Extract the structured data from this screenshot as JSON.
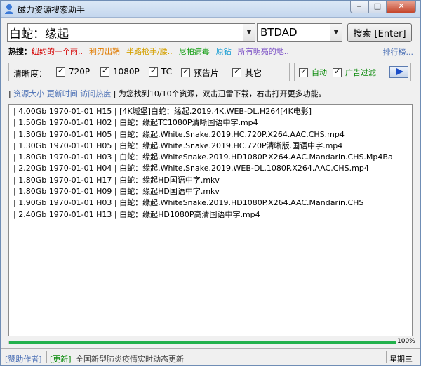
{
  "window": {
    "title": "磁力资源搜索助手",
    "controls": {
      "minimize": "‒",
      "maximize": "□",
      "close": "✕"
    }
  },
  "search": {
    "query": "白蛇：缘起",
    "engine": "BTDAD",
    "button_label": "搜索 [Enter]"
  },
  "hot": {
    "label": "热搜：",
    "keywords": [
      {
        "text": "纽约的一个雨..",
        "color": "#d40000"
      },
      {
        "text": "利刃出鞘",
        "color": "#e07b00"
      },
      {
        "text": "半路枪手/腰..",
        "color": "#d4a000"
      },
      {
        "text": "尼帕病毒",
        "color": "#0a9a0a"
      },
      {
        "text": "原钻",
        "color": "#1e9fd4"
      },
      {
        "text": "所有明亮的地..",
        "color": "#7a4fc5"
      }
    ],
    "rank_link": "排行榜..."
  },
  "filter": {
    "label": "清晰度：",
    "options": [
      "720P",
      "1080P",
      "TC",
      "预告片",
      "其它"
    ]
  },
  "auto": {
    "auto_label": "自动",
    "ad_filter_label": "广告过滤"
  },
  "info": {
    "sort_size": "资源大小",
    "sort_time": "更新时间",
    "sort_hot": "访问热度",
    "summary": "为您找到10/10个资源，双击迅雷下载，右击打开更多功能。"
  },
  "results": [
    "| 4.00Gb 1970-01-01 H15 | [4K城堡]白蛇：缘起.2019.4K.WEB-DL.H264[4K电影]",
    "| 1.50Gb 1970-01-01 H02 | 白蛇：缘起TC1080P清晰国语中字.mp4",
    "| 1.30Gb 1970-01-01 H05 | 白蛇：缘起.White.Snake.2019.HC.720P.X264.AAC.CHS.mp4",
    "| 1.30Gb 1970-01-01 H05 | 白蛇：缘起.White.Snake.2019.HC.720P清晰版.国语中字.mp4",
    "| 1.80Gb 1970-01-01 H03 | 白蛇：缘起.WhiteSnake.2019.HD1080P.X264.AAC.Mandarin.CHS.Mp4Ba",
    "| 2.20Gb 1970-01-01 H04 | 白蛇：缘起.White.Snake.2019.WEB-DL.1080P.X264.AAC.CHS.mp4",
    "| 1.80Gb 1970-01-01 H17 | 白蛇：缘起HD国语中字.mkv",
    "| 1.80Gb 1970-01-01 H09 | 白蛇：缘起HD国语中字.mkv",
    "| 1.90Gb 1970-01-01 H03 | 白蛇：缘起.WhiteSnake.2019.HD1080P.X264.AAC.Mandarin.CHS",
    "| 2.40Gb 1970-01-01 H13 | 白蛇：缘起HD1080P高清国语中字.mp4"
  ],
  "progress": {
    "value": 1.0,
    "label": "100%"
  },
  "status": {
    "sponsor": "[赞助作者]",
    "update": "[更新]",
    "news": "全国新型肺炎疫情实时动态更新",
    "weekday": "星期三"
  },
  "colors": {
    "link": "#4a6fb5",
    "green": "#0a8a0a",
    "progress": "#22b14c"
  }
}
